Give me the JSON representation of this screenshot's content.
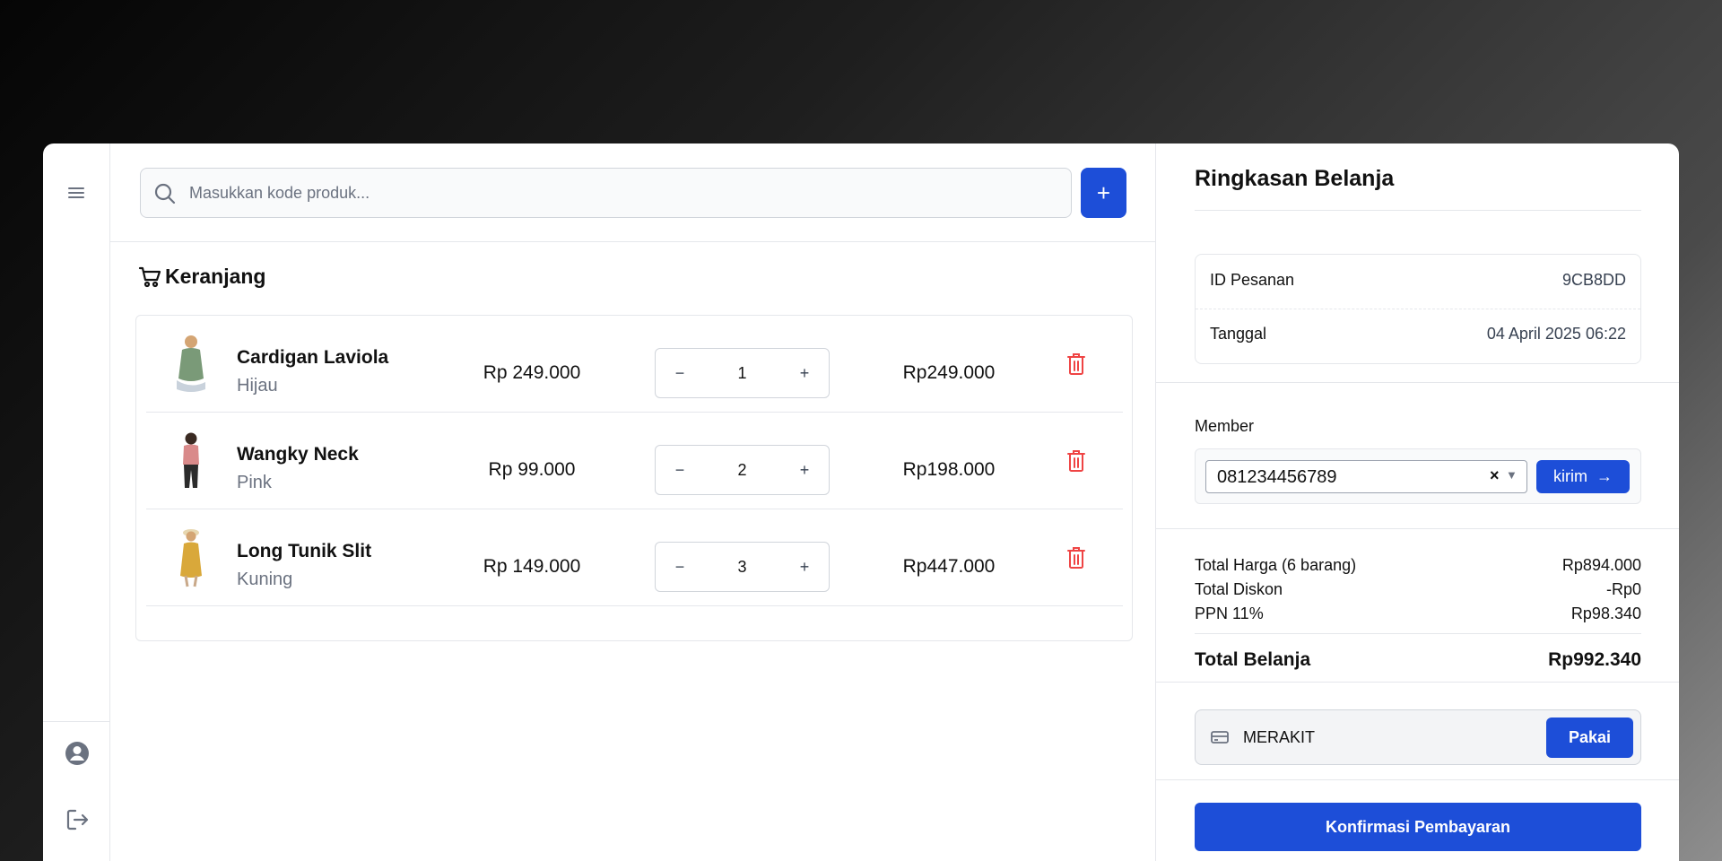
{
  "search": {
    "placeholder": "Masukkan kode produk...",
    "add_label": "+"
  },
  "cart": {
    "title": "Keranjang",
    "items": [
      {
        "name": "Cardigan Laviola",
        "variant": "Hijau",
        "price": "Rp 249.000",
        "qty": "1",
        "subtotal": "Rp249.000",
        "thumb_color": "#6b8e6b"
      },
      {
        "name": "Wangky Neck",
        "variant": "Pink",
        "price": "Rp 99.000",
        "qty": "2",
        "subtotal": "Rp198.000",
        "thumb_color": "#d98a8a"
      },
      {
        "name": "Long Tunik Slit",
        "variant": "Kuning",
        "price": "Rp 149.000",
        "qty": "3",
        "subtotal": "Rp447.000",
        "thumb_color": "#d9a83a"
      }
    ],
    "minus_label": "−",
    "plus_label": "+"
  },
  "summary": {
    "title": "Ringkasan Belanja",
    "order_id_label": "ID Pesanan",
    "order_id_value": "9CB8DD",
    "date_label": "Tanggal",
    "date_value": "04 April 2025 06:22",
    "member_label": "Member",
    "member_value": "081234456789",
    "member_clear": "×",
    "member_caret": "▼",
    "send_label": "kirim",
    "send_arrow": "→",
    "total_price_label": "Total Harga (6 barang)",
    "total_price_value": "Rp894.000",
    "total_discount_label": "Total Diskon",
    "total_discount_value": "-Rp0",
    "tax_label": "PPN 11%",
    "tax_value": "Rp98.340",
    "grand_total_label": "Total Belanja",
    "grand_total_value": "Rp992.340",
    "voucher_value": "MERAKIT",
    "apply_label": "Pakai",
    "confirm_label": "Konfirmasi Pembayaran"
  },
  "colors": {
    "primary": "#1d4ed8",
    "danger": "#ef4444",
    "muted_text": "#6b7280",
    "border": "#e5e7eb"
  },
  "icons": {
    "menu": "hamburger-icon",
    "search": "search-icon",
    "cart": "cart-icon",
    "trash": "trash-icon",
    "profile": "user-circle-icon",
    "logout": "logout-icon",
    "voucher": "credit-card-icon"
  }
}
